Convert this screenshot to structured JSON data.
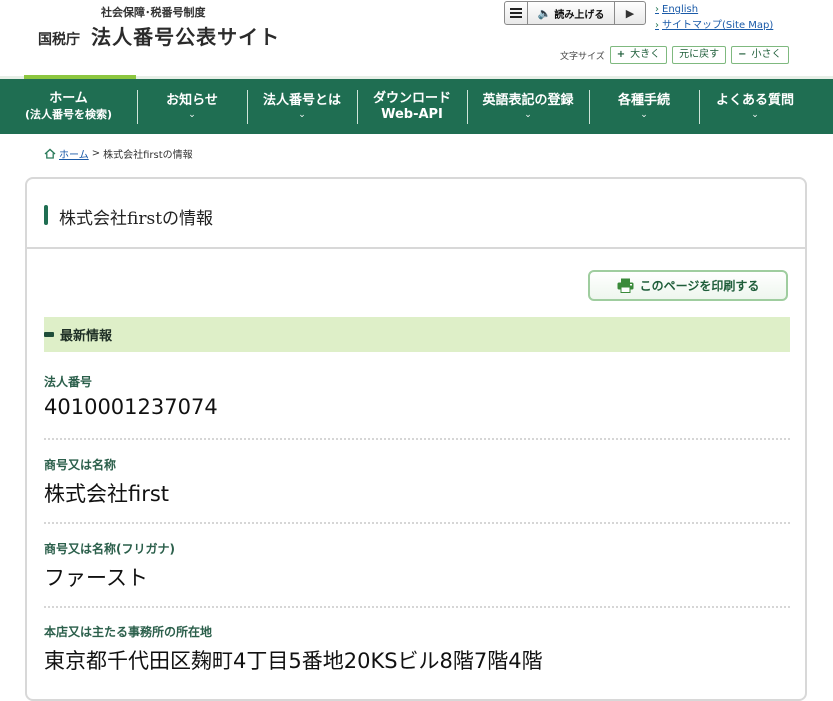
{
  "header": {
    "subtitle": "社会保障･税番号制度",
    "agency": "国税庁",
    "site_title": "法人番号公表サイト",
    "reader_label": "読み上げる",
    "english_link": "English",
    "sitemap_link": "サイトマップ(Site Map)",
    "font_size_label": "文字サイズ",
    "font_larger": "大きく",
    "font_reset": "元に戻す",
    "font_smaller": "小さく"
  },
  "nav": {
    "items": [
      {
        "label": "ホーム",
        "sub": "(法人番号を検索)"
      },
      {
        "label": "お知らせ"
      },
      {
        "label": "法人番号とは"
      },
      {
        "label": "ダウンロード",
        "sub": "Web-API"
      },
      {
        "label": "英語表記の登録"
      },
      {
        "label": "各種手続"
      },
      {
        "label": "よくある質問"
      }
    ]
  },
  "breadcrumb": {
    "home": "ホーム",
    "separator": ">",
    "current": "株式会社firstの情報"
  },
  "panel": {
    "title": "株式会社firstの情報",
    "print_label": "このページを印刷する",
    "section_title": "最新情報"
  },
  "fields": [
    {
      "label": "法人番号",
      "value": "4010001237074"
    },
    {
      "label": "商号又は名称",
      "value": "株式会社first"
    },
    {
      "label": "商号又は名称(フリガナ)",
      "value": "ファースト"
    },
    {
      "label": "本店又は主たる事務所の所在地",
      "value": "東京都千代田区麹町4丁目5番地20KSビル8階7階4階"
    }
  ],
  "colors": {
    "nav_bg": "#1f6e52",
    "accent_green": "#8cc63f",
    "section_bg": "#deefc8",
    "label_green": "#2b5f4b"
  },
  "icons": [
    "menu-icon",
    "speaker-icon",
    "play-icon",
    "arrow-right-icon",
    "plus-icon",
    "minus-icon",
    "chevron-down-icon",
    "home-icon",
    "printer-icon"
  ]
}
